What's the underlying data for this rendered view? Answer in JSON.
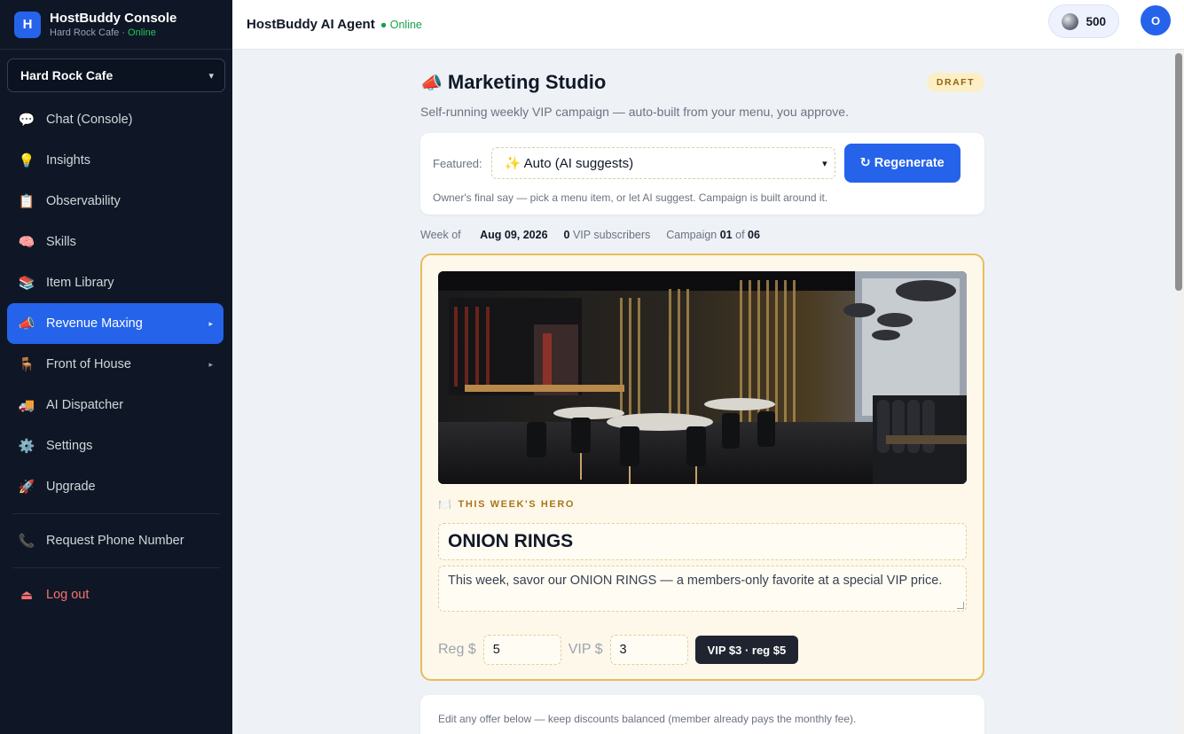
{
  "brand": {
    "logo_letter": "H",
    "title": "HostBuddy Console",
    "venue_name": "Hard Rock Cafe",
    "separator": " · ",
    "status": "Online"
  },
  "venue_selector": {
    "selected": "Hard Rock Cafe"
  },
  "nav": [
    {
      "label": "Chat (Console)",
      "icon": "💬",
      "icon_name": "chat-icon"
    },
    {
      "label": "Insights",
      "icon": "💡",
      "icon_name": "lightbulb-icon"
    },
    {
      "label": "Observability",
      "icon": "📋",
      "icon_name": "clipboard-icon"
    },
    {
      "label": "Skills",
      "icon": "🧠",
      "icon_name": "brain-icon"
    },
    {
      "label": "Item Library",
      "icon": "📚",
      "icon_name": "books-icon"
    },
    {
      "label": "Revenue Maxing",
      "icon": "📣",
      "icon_name": "megaphone-icon",
      "active": true,
      "has_submenu": true
    },
    {
      "label": "Front of House",
      "icon": "🪑",
      "icon_name": "chair-icon",
      "has_submenu": true
    },
    {
      "label": "AI Dispatcher",
      "icon": "🚚",
      "icon_name": "truck-icon"
    },
    {
      "label": "Settings",
      "icon": "⚙️",
      "icon_name": "gear-icon"
    },
    {
      "label": "Upgrade",
      "icon": "🚀",
      "icon_name": "rocket-icon"
    }
  ],
  "nav_extra": {
    "phone_label": "Request Phone Number",
    "phone_icon": "📞",
    "logout_label": "Log out",
    "logout_icon": "⏏"
  },
  "topbar": {
    "agent_title": "HostBuddy AI Agent",
    "status": "● Online",
    "credits": "500",
    "avatar_letter": "O"
  },
  "studio": {
    "icon": "📣",
    "title": "Marketing Studio",
    "badge": "DRAFT",
    "subtitle": "Self-running weekly VIP campaign — auto-built from your menu, you approve."
  },
  "featured": {
    "label": "Featured:",
    "selected": "✨ Auto (AI suggests)",
    "regen_label": "↻ Regenerate",
    "help": "Owner's final say — pick a menu item, or let AI suggest. Campaign is built around it."
  },
  "meta": {
    "week_prefix": "Week of ",
    "week_value": "Aug 09, 2026",
    "subs_value": "0",
    "subs_suffix": " VIP subscribers",
    "campaign_prefix": "Campaign ",
    "campaign_value": "01",
    "campaign_of": " of ",
    "campaign_total": "06"
  },
  "hero": {
    "label_icon": "🍽️",
    "label": "THIS WEEK'S HERO",
    "name": "ONION RINGS",
    "description": "This week, savor our ONION RINGS — a members-only favorite at a special VIP price.",
    "reg_label": "Reg $",
    "reg_value": "5",
    "vip_label": "VIP $",
    "vip_value": "3",
    "summary": "VIP $3 · reg $5"
  },
  "offers": {
    "help": "Edit any offer below — keep discounts balanced (member already pays the monthly fee)."
  },
  "colors": {
    "accent": "#2563eb",
    "sidebar_bg": "#0f1726",
    "hero_border": "#e7bd5a",
    "online": "#22c55e"
  }
}
